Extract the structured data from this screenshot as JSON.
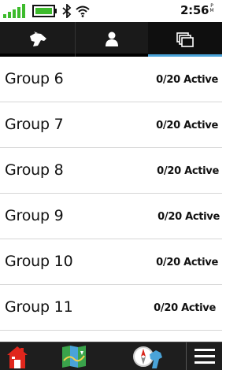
{
  "status_bar": {
    "time": "2:56",
    "ampm_top": "P",
    "ampm_bottom": "M",
    "icons": [
      "signal-icon",
      "battery-icon",
      "bluetooth-icon",
      "wifi-icon"
    ],
    "battery_level": 1.0
  },
  "tabs": [
    {
      "icon": "dog-icon",
      "selected": false
    },
    {
      "icon": "person-icon",
      "selected": false
    },
    {
      "icon": "groups-icon",
      "selected": true
    }
  ],
  "groups": [
    {
      "name": "Group 6",
      "status": "0/20 Active"
    },
    {
      "name": "Group 7",
      "status": "0/20 Active"
    },
    {
      "name": "Group 8",
      "status": "0/20 Active"
    },
    {
      "name": "Group 9",
      "status": "0/20 Active"
    },
    {
      "name": "Group 10",
      "status": "0/20 Active"
    },
    {
      "name": "Group 11",
      "status": "0/20 Active"
    }
  ],
  "bottom_bar": {
    "buttons": [
      "home-icon",
      "map-icon",
      "compass-dog-icon",
      "menu-icon"
    ]
  },
  "colors": {
    "accent": "#4aa3d8",
    "battery": "#3dbb2c",
    "tab_bg": "#1a1a1a",
    "bottom_bg": "#1e1e1e"
  }
}
